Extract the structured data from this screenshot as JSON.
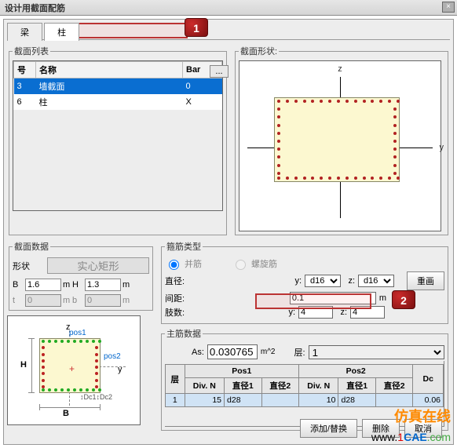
{
  "title": "设计用截面配筋",
  "tabs": {
    "beam": "梁",
    "column": "柱"
  },
  "marker1": "1",
  "marker2": "2",
  "section_list": {
    "legend": "截面列表",
    "dots": "...",
    "headers": {
      "id": "号",
      "name": "名称",
      "bar": "Bar"
    },
    "rows": [
      {
        "id": "3",
        "name": "墙截面",
        "bar": "0"
      },
      {
        "id": "6",
        "name": "柱",
        "bar": "X"
      }
    ]
  },
  "section_shape_legend": "截面形状:",
  "axis_z": "z",
  "axis_y": "y",
  "section_data": {
    "legend": "截面数据",
    "shape_label": "形状",
    "shape_value": "实心矩形",
    "B_label": "B",
    "B_val": "1.6",
    "B_unit": "m",
    "H_label": "H",
    "H_val": "1.3",
    "H_unit": "m",
    "t_label": "t",
    "t_val": "0",
    "t_unit": "m",
    "b_label": "b",
    "b_val": "0",
    "b_unit": "m",
    "pos1": "pos1",
    "pos2": "pos2",
    "z": "z",
    "y": "y",
    "Hletter": "H",
    "Bletter": "B",
    "dc": "↕Dc1↕Dc2"
  },
  "stirrup": {
    "legend": "箍筋类型",
    "radio_poly": "并筋",
    "radio_spiral": "螺旋筋",
    "dia_label": "直径:",
    "y_label": "y:",
    "z_label": "z:",
    "dia_y": "d16",
    "dia_z": "d16",
    "spacing_label": "间距:",
    "spacing_val": "0.1",
    "spacing_unit": "m",
    "legs_label": "肢数:",
    "legs_y": "4",
    "legs_z": "4",
    "redraw": "重画"
  },
  "main_rebar": {
    "legend": "主筋数据",
    "as_label": "As:",
    "as_val": "0.030765",
    "as_unit": "m^2",
    "floor_label": "层:",
    "floor_val": "1",
    "headers": {
      "floor": "层",
      "pos1": "Pos1",
      "pos2": "Pos2",
      "divn": "Div. N",
      "dia1": "直径1",
      "dia2": "直径2",
      "dc": "Dc"
    },
    "row": {
      "floor": "1",
      "p1_divn": "15",
      "p1_d1": "d28",
      "p1_d2": "",
      "p2_divn": "10",
      "p2_d1": "d28",
      "p2_d2": "",
      "dc": "0.06"
    }
  },
  "buttons": {
    "add": "添加/替换",
    "del": "删除",
    "cancel": "取消"
  },
  "watermark1": "仿真在线",
  "watermark2": {
    "a": "www.",
    "b": "1",
    "c": "CAE",
    "d": ".com"
  }
}
